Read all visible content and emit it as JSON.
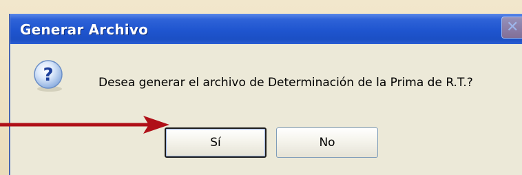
{
  "dialog": {
    "title": "Generar Archivo",
    "message": "Desea generar el archivo de Determinación de la Prima de R.T.?",
    "icon": "question-icon",
    "close_icon": "close-icon",
    "buttons": {
      "yes_label": "Sí",
      "no_label": "No"
    }
  },
  "annotation": {
    "arrow_color": "#b01018",
    "target": "Sí"
  },
  "colors": {
    "titlebar": "#2558d6",
    "dialog_body": "#ece9d8",
    "backdrop": "#efe3c6"
  }
}
